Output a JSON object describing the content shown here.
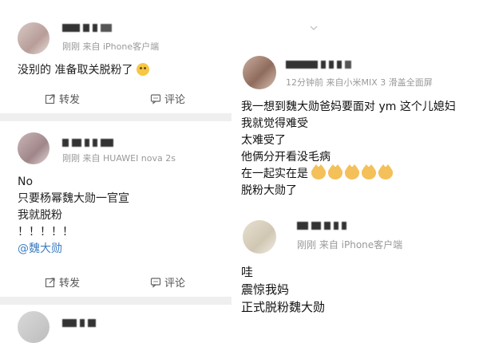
{
  "left": {
    "post1": {
      "meta_time": "刚刚",
      "meta_source": "来自 iPhone客户端",
      "text": "没别的 准备取关脱粉了"
    },
    "actions1": {
      "repost": "转发",
      "comment": "评论"
    },
    "post2": {
      "meta_time": "刚刚",
      "meta_source": "来自 HUAWEI nova 2s",
      "lines": [
        "No",
        "只要杨幂魏大勋一官宣",
        "我就脱粉",
        "！！！！！"
      ],
      "mention": "@魏大勋"
    },
    "actions2": {
      "repost": "转发",
      "comment": "评论"
    }
  },
  "right": {
    "post1": {
      "meta_time": "12分钟前",
      "meta_source": "来自小米MIX 3 滑盖全面屏",
      "lines": [
        "我一想到魏大勋爸妈要面对 ym 这个儿媳妇",
        "我就觉得难受",
        "太难受了",
        "他俩分开看没毛病",
        "在一起实在是"
      ],
      "last_line": "脱粉大勋了"
    },
    "post2": {
      "meta_time": "刚刚",
      "meta_source": "来自 iPhone客户端",
      "lines": [
        "哇",
        "震惊我妈",
        "正式脱粉魏大勋"
      ]
    }
  },
  "colors": {
    "divider": "#efefef",
    "meta": "#999999",
    "mention": "#3d7ec4"
  }
}
